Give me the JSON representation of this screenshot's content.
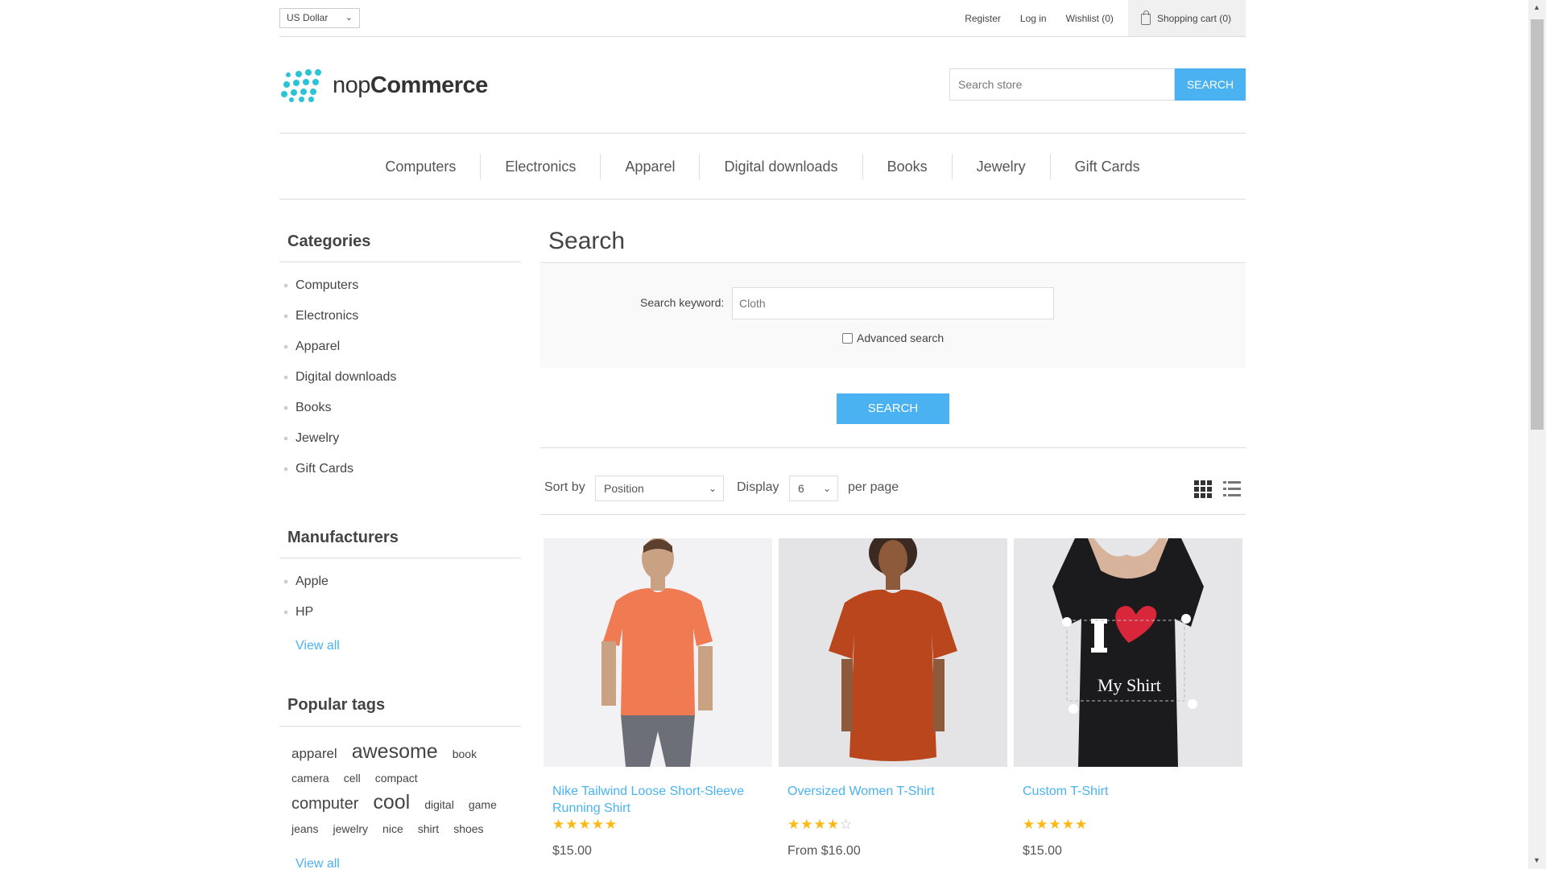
{
  "header": {
    "currency": "US Dollar",
    "links": {
      "register": "Register",
      "login": "Log in",
      "wishlist": "Wishlist (0)",
      "cart": "Shopping cart (0)"
    },
    "logo_light": "nop",
    "logo_bold": "Commerce",
    "search_placeholder": "Search store",
    "search_button": "SEARCH"
  },
  "nav": [
    "Computers",
    "Electronics",
    "Apparel",
    "Digital downloads",
    "Books",
    "Jewelry",
    "Gift Cards"
  ],
  "sidebar": {
    "categories_title": "Categories",
    "categories": [
      "Computers",
      "Electronics",
      "Apparel",
      "Digital downloads",
      "Books",
      "Jewelry",
      "Gift Cards"
    ],
    "manufacturers_title": "Manufacturers",
    "manufacturers": [
      "Apple",
      "HP"
    ],
    "manufacturers_view_all": "View all",
    "tags_title": "Popular tags",
    "tags": [
      "apparel",
      "awesome",
      "book",
      "camera",
      "cell",
      "compact",
      "computer",
      "cool",
      "digital",
      "game",
      "jeans",
      "jewelry",
      "nice",
      "shirt",
      "shoes"
    ],
    "tags_view_all": "View all"
  },
  "main": {
    "title": "Search",
    "keyword_label": "Search keyword:",
    "keyword_value": "Cloth",
    "advanced_label": "Advanced search",
    "search_button": "SEARCH",
    "sort_label": "Sort by",
    "sort_value": "Position",
    "display_label": "Display",
    "display_value": "6",
    "per_page": "per page"
  },
  "products": [
    {
      "title": "Nike Tailwind Loose Short-Sleeve Running Shirt",
      "rating": 5,
      "price": "$15.00"
    },
    {
      "title": "Oversized Women T-Shirt",
      "rating": 4,
      "price": "From $16.00"
    },
    {
      "title": "Custom T-Shirt",
      "rating": 5,
      "price": "$15.00"
    }
  ],
  "custom_shirt_text": {
    "letter": "I",
    "caption": "My Shirt"
  },
  "colors": {
    "accent": "#4ab2f1",
    "logo": "#2bc4d6",
    "star": "#fdb813"
  }
}
